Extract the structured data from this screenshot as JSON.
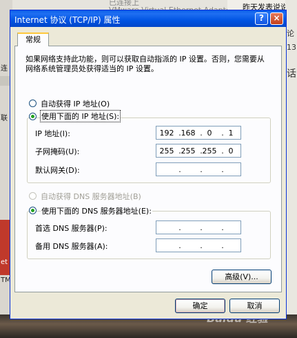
{
  "background": {
    "left_fragments": [
      "连",
      "联",
      "et",
      "TM"
    ],
    "top_strip_text": "VMware Virtual Ethernet Adapter",
    "top_strip_text2": "已连接上",
    "top_right_text": "昨天发表说说",
    "right_fragments": [
      "论",
      "13",
      "话"
    ],
    "watermark": "Baidu 经验"
  },
  "dialog": {
    "title": "Internet 协议 (TCP/IP) 属性",
    "help_glyph": "?",
    "close_glyph": "×",
    "tab_label": "常规",
    "description": "如果网络支持此功能，则可以获取自动指派的 IP 设置。否则，您需要从网络系统管理员处获得适当的 IP 设置。",
    "ip_section": {
      "auto_label": "自动获得 IP 地址(O)",
      "manual_label": "使用下面的 IP 地址(S):",
      "selected": "manual",
      "fields": [
        {
          "label": "IP 地址(I):",
          "octets": [
            "192",
            "168",
            "0",
            "1"
          ]
        },
        {
          "label": "子网掩码(U):",
          "octets": [
            "255",
            "255",
            "255",
            "0"
          ]
        },
        {
          "label": "默认网关(D):",
          "octets": [
            "",
            "",
            "",
            ""
          ]
        }
      ]
    },
    "dns_section": {
      "auto_label": "自动获得 DNS 服务器地址(B)",
      "manual_label": "使用下面的 DNS 服务器地址(E):",
      "selected": "manual",
      "fields": [
        {
          "label": "首选 DNS 服务器(P):",
          "octets": [
            "",
            "",
            "",
            ""
          ]
        },
        {
          "label": "备用 DNS 服务器(A):",
          "octets": [
            "",
            "",
            "",
            ""
          ]
        }
      ]
    },
    "advanced_label": "高级(V)...",
    "ok_label": "确定",
    "cancel_label": "取消"
  }
}
